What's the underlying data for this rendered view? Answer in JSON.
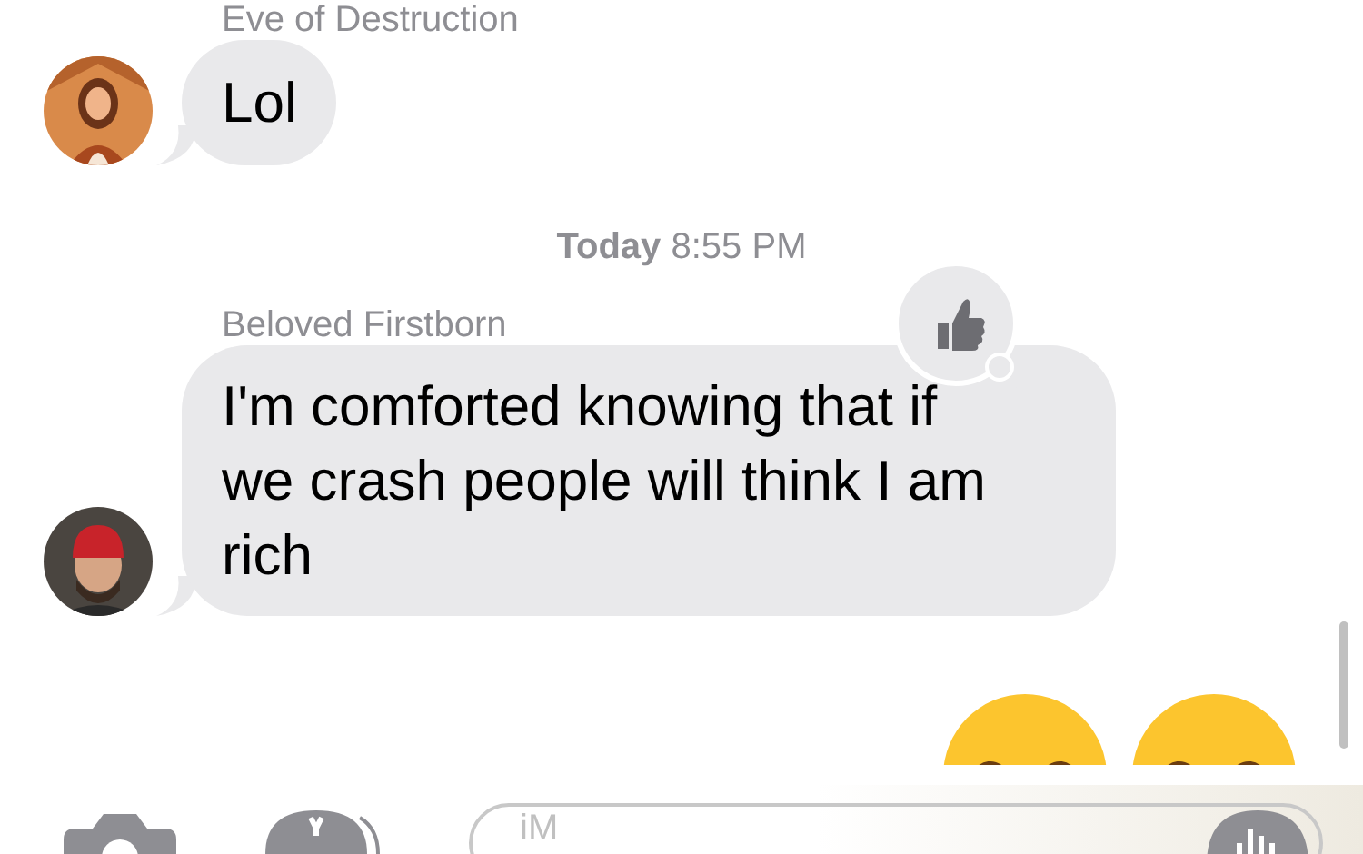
{
  "messages": [
    {
      "kind": "incoming",
      "sender": "Eve of Destruction",
      "text": "Lol"
    },
    {
      "kind": "timestamp",
      "text": "**Today** 8:55 PM"
    },
    {
      "kind": "incoming",
      "sender": "Beloved Firstborn",
      "text": "I'm comforted knowing that if we crash people will think I am rich",
      "liked": true
    },
    {
      "kind": "emoji"
    }
  ],
  "compose": {
    "placeholder": "iM"
  }
}
